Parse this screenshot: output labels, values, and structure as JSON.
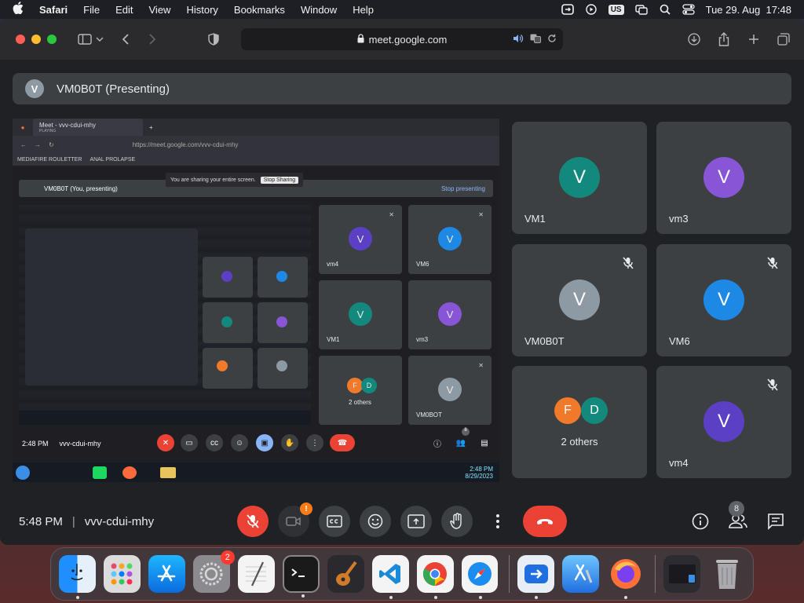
{
  "menubar": {
    "app_name": "Safari",
    "items": [
      "File",
      "Edit",
      "View",
      "History",
      "Bookmarks",
      "Window",
      "Help"
    ],
    "input_source": "US",
    "datetime": "Tue 29. Aug  17:48"
  },
  "browser": {
    "url": "meet.google.com"
  },
  "meet": {
    "presenter_initial": "V",
    "presenter_title": "VM0B0T (Presenting)",
    "shared_screen": {
      "tab_title": "Meet - vvv-cdui-mhy",
      "tab_subtitle": "PLAYING",
      "url": "https://meet.google.com/vvv-cdui-mhy",
      "bookmarks": [
        "MEDIAFIRE ROULETTER",
        "ANAL PROLAPSE"
      ],
      "sharing_text": "You are sharing your entire screen.",
      "stop_sharing": "Stop Sharing",
      "present_label": "VM0B0T (You, presenting)",
      "stop_presenting": "Stop presenting",
      "tiles": [
        {
          "name": "vm4",
          "initial": "V",
          "color": "#5b3fc4"
        },
        {
          "name": "VM6",
          "initial": "V",
          "color": "#1e88e5"
        },
        {
          "name": "VM1",
          "initial": "V",
          "color": "#12897c"
        },
        {
          "name": "vm3",
          "initial": "V",
          "color": "#8855d6"
        },
        {
          "name": "2 others",
          "initial": "F D",
          "color": "#f07a2a"
        },
        {
          "name": "VM0BOT",
          "initial": "V",
          "color": "#8e9aa3"
        }
      ],
      "time": "2:48 PM",
      "meeting_code": "vvv-cdui-mhy",
      "people_count": "8",
      "taskbar_time": "2:48 PM",
      "taskbar_date": "8/29/2023"
    },
    "tiles": [
      {
        "name": "VM1",
        "initial": "V",
        "color": "#12897c",
        "muted": false
      },
      {
        "name": "vm3",
        "initial": "V",
        "color": "#8855d6",
        "muted": false
      },
      {
        "name": "VM0B0T",
        "initial": "V",
        "color": "#8e9aa3",
        "muted": true
      },
      {
        "name": "VM6",
        "initial": "V",
        "color": "#1e88e5",
        "muted": true
      },
      {
        "name": "2 others",
        "initials": [
          "F",
          "D"
        ],
        "colors": [
          "#f07a2a",
          "#12897c"
        ],
        "muted": false
      },
      {
        "name": "vm4",
        "initial": "V",
        "color": "#5b3fc4",
        "muted": true
      }
    ],
    "controls": {
      "time": "5:48 PM",
      "meeting_code": "vvv-cdui-mhy",
      "camera_alert": "!",
      "people_count": "8"
    }
  },
  "dock": {
    "settings_badge": "2"
  }
}
